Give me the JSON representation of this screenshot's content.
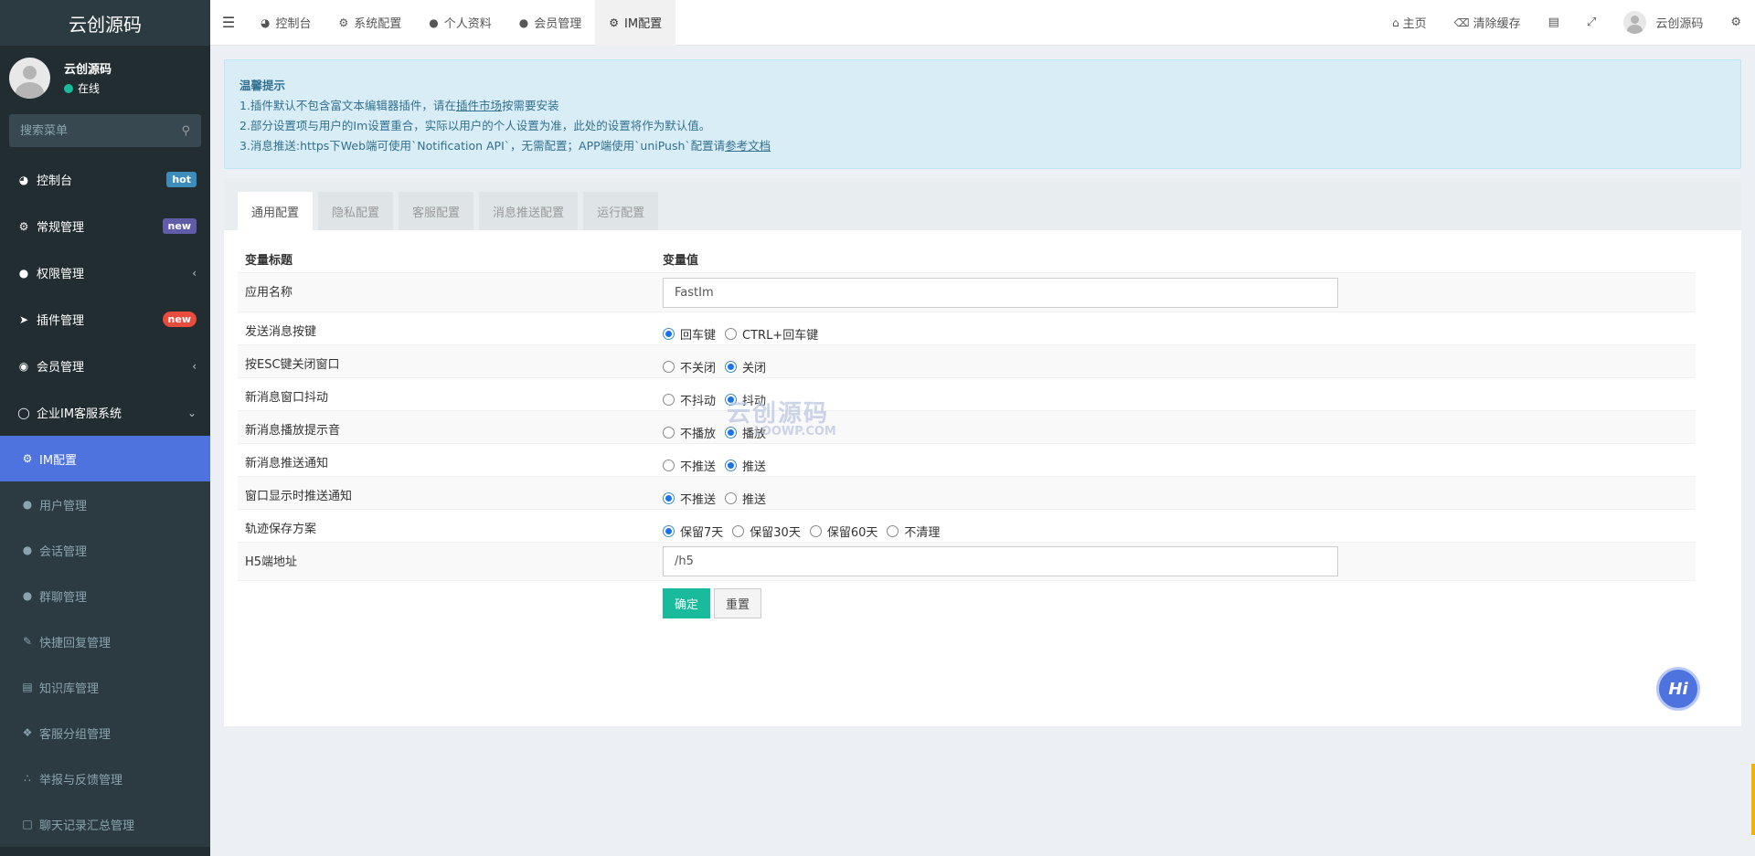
{
  "sidebar": {
    "logo": "云创源码",
    "user": {
      "name": "云创源码",
      "status": "在线"
    },
    "search_placeholder": "搜索菜单",
    "menu": [
      {
        "label": "控制台",
        "icon": "dashboard-icon",
        "badge": "hot"
      },
      {
        "label": "常规管理",
        "icon": "cogs-icon",
        "badge": "new"
      },
      {
        "label": "权限管理",
        "icon": "users-icon"
      },
      {
        "label": "插件管理",
        "icon": "rocket-icon",
        "badge": "new"
      },
      {
        "label": "会员管理",
        "icon": "user-circle-icon"
      },
      {
        "label": "企业IM客服系统",
        "icon": "comment-icon"
      }
    ],
    "submenu": [
      {
        "label": "IM配置",
        "icon": "cogs-icon"
      },
      {
        "label": "用户管理",
        "icon": "users-icon"
      },
      {
        "label": "会话管理",
        "icon": "user-icon"
      },
      {
        "label": "群聊管理",
        "icon": "users-icon"
      },
      {
        "label": "快捷回复管理",
        "icon": "pencil-icon"
      },
      {
        "label": "知识库管理",
        "icon": "book-icon"
      },
      {
        "label": "客服分组管理",
        "icon": "cubes-icon"
      },
      {
        "label": "举报与反馈管理",
        "icon": "rss-icon"
      },
      {
        "label": "聊天记录汇总管理",
        "icon": "file-icon"
      }
    ]
  },
  "header": {
    "tabs": [
      {
        "label": "控制台",
        "icon": "dashboard-icon"
      },
      {
        "label": "系统配置",
        "icon": "cog-icon"
      },
      {
        "label": "个人资料",
        "icon": "user-icon"
      },
      {
        "label": "会员管理",
        "icon": "user-icon"
      },
      {
        "label": "IM配置",
        "icon": "cogs-icon"
      }
    ],
    "home": "主页",
    "clear_cache": "清除缓存",
    "username": "云创源码"
  },
  "tips": {
    "title": "温馨提示",
    "line1_prefix": "1.插件默认不包含富文本编辑器插件，请在",
    "line1_link": "插件市场",
    "line1_suffix": "按需要安装",
    "line2": "2.部分设置项与用户的Im设置重合，实际以用户的个人设置为准，此处的设置将作为默认值。",
    "line3_prefix": "3.消息推送:https下Web端可使用`Notification API`，无需配置；APP端使用`uniPush`配置请",
    "line3_link": "参考文档"
  },
  "config_tabs": [
    "通用配置",
    "隐私配置",
    "客服配置",
    "消息推送配置",
    "运行配置"
  ],
  "table": {
    "col_title": "变量标题",
    "col_value": "变量值",
    "rows": [
      {
        "label": "应用名称",
        "type": "text",
        "value": "FastIm"
      },
      {
        "label": "发送消息按键",
        "type": "radio",
        "options": [
          "回车键",
          "CTRL+回车键"
        ],
        "selected": 0
      },
      {
        "label": "按ESC键关闭窗口",
        "type": "radio",
        "options": [
          "不关闭",
          "关闭"
        ],
        "selected": 1
      },
      {
        "label": "新消息窗口抖动",
        "type": "radio",
        "options": [
          "不抖动",
          "抖动"
        ],
        "selected": 1
      },
      {
        "label": "新消息播放提示音",
        "type": "radio",
        "options": [
          "不播放",
          "播放"
        ],
        "selected": 1
      },
      {
        "label": "新消息推送通知",
        "type": "radio",
        "options": [
          "不推送",
          "推送"
        ],
        "selected": 1
      },
      {
        "label": "窗口显示时推送通知",
        "type": "radio",
        "options": [
          "不推送",
          "推送"
        ],
        "selected": 0
      },
      {
        "label": "轨迹保存方案",
        "type": "radio",
        "options": [
          "保留7天",
          "保留30天",
          "保留60天",
          "不清理"
        ],
        "selected": 0
      },
      {
        "label": "H5端地址",
        "type": "text",
        "value": "/h5"
      }
    ]
  },
  "buttons": {
    "submit": "确定",
    "reset": "重置"
  },
  "chat_bubble": "Hi",
  "watermark": {
    "top": "云创源码",
    "bottom": "LOOWP.COM"
  }
}
